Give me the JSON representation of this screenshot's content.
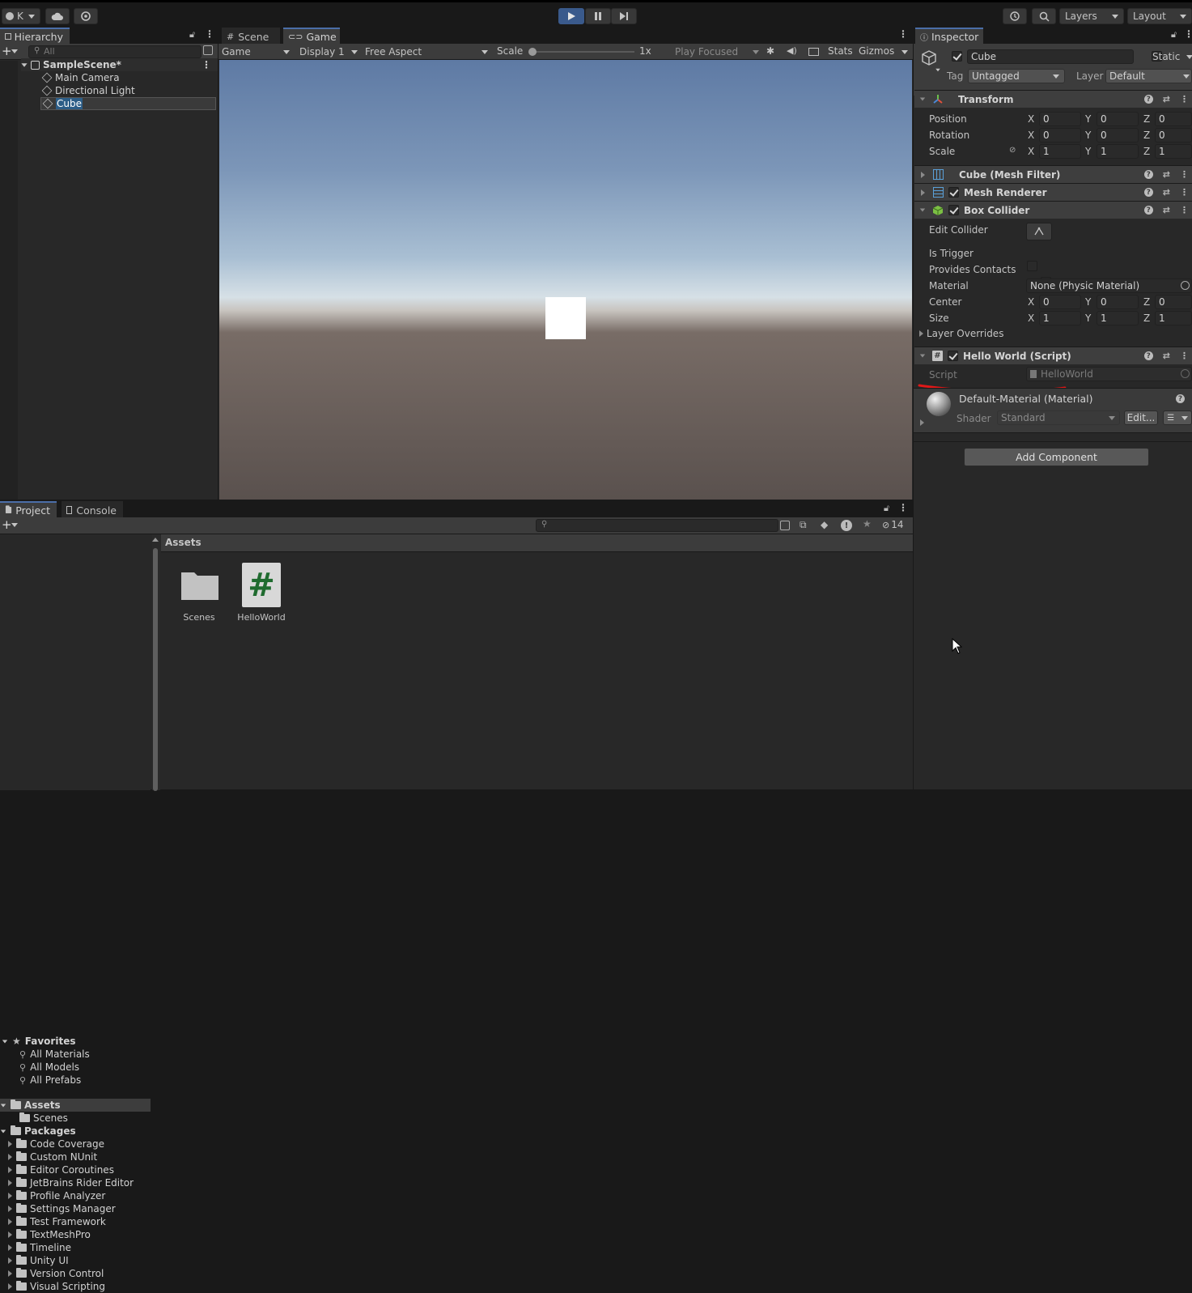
{
  "toolbar": {
    "account_label": "K",
    "layers_label": "Layers",
    "layout_label": "Layout"
  },
  "hierarchy": {
    "tab_label": "Hierarchy",
    "search_placeholder": "All",
    "scene_name": "SampleScene*",
    "items": [
      {
        "label": "Main Camera"
      },
      {
        "label": "Directional Light"
      },
      {
        "label": "Cube"
      }
    ]
  },
  "game_view": {
    "tabs": [
      "Scene",
      "Game"
    ],
    "mode": "Game",
    "display": "Display 1",
    "aspect": "Free Aspect",
    "scale_label": "Scale",
    "scale_value": "1x",
    "play_focused": "Play Focused",
    "stats": "Stats",
    "gizmos": "Gizmos"
  },
  "inspector": {
    "tab_label": "Inspector",
    "object_name": "Cube",
    "static_label": "Static",
    "tag_label": "Tag",
    "tag_value": "Untagged",
    "layer_label": "Layer",
    "layer_value": "Default",
    "transform": {
      "title": "Transform",
      "rows": [
        {
          "label": "Position",
          "x": "0",
          "y": "0",
          "z": "0"
        },
        {
          "label": "Rotation",
          "x": "0",
          "y": "0",
          "z": "0"
        },
        {
          "label": "Scale",
          "x": "1",
          "y": "1",
          "z": "1"
        }
      ]
    },
    "mesh_filter_title": "Cube (Mesh Filter)",
    "mesh_renderer_title": "Mesh Renderer",
    "box_collider": {
      "title": "Box Collider",
      "edit_collider": "Edit Collider",
      "is_trigger": "Is Trigger",
      "provides_contacts": "Provides Contacts",
      "material_label": "Material",
      "material_value": "None (Physic Material)",
      "center_label": "Center",
      "center": {
        "x": "0",
        "y": "0",
        "z": "0"
      },
      "size_label": "Size",
      "size": {
        "x": "1",
        "y": "1",
        "z": "1"
      },
      "layer_overrides": "Layer Overrides"
    },
    "script_component": {
      "title": "Hello World (Script)",
      "script_label": "Script",
      "script_value": "HelloWorld"
    },
    "material": {
      "title": "Default-Material (Material)",
      "shader_label": "Shader",
      "shader_value": "Standard",
      "edit_button": "Edit..."
    },
    "add_component": "Add Component",
    "axis_labels": [
      "X",
      "Y",
      "Z"
    ]
  },
  "project": {
    "tabs": [
      "Project",
      "Console"
    ],
    "hidden_count": "14",
    "favorites_label": "Favorites",
    "favorites": [
      "All Materials",
      "All Models",
      "All Prefabs"
    ],
    "assets_label": "Assets",
    "assets_children": [
      "Scenes"
    ],
    "packages_label": "Packages",
    "packages": [
      "Code Coverage",
      "Custom NUnit",
      "Editor Coroutines",
      "JetBrains Rider Editor",
      "Profile Analyzer",
      "Settings Manager",
      "Test Framework",
      "TextMeshPro",
      "Timeline",
      "Unity UI",
      "Version Control",
      "Visual Scripting"
    ],
    "breadcrumb": "Assets",
    "grid_items": [
      {
        "label": "Scenes",
        "icon": "folder-icon"
      },
      {
        "label": "HelloWorld",
        "icon": "csharp-script-icon"
      }
    ]
  },
  "colors": {
    "accent": "#4b6ea8",
    "play_active": "#3a5a8c",
    "annotation": "#e01818"
  }
}
